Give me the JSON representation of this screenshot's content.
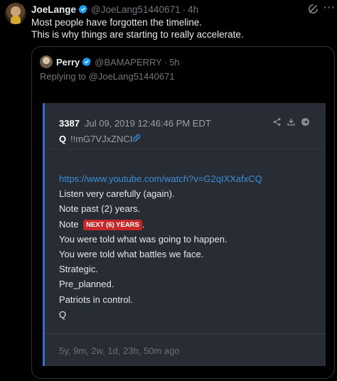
{
  "post": {
    "author_name": "JoeLange",
    "author_handle": "@JoeLang51440671",
    "separator": "·",
    "time": "4h",
    "text_lines": [
      "Most people have forgotten the timeline.",
      "This is why things are starting to really accelerate."
    ]
  },
  "quoted": {
    "author_name": "Perry",
    "author_handle": "@BAMAPERRY",
    "separator": "·",
    "time": "5h",
    "reply_text": "Replying to @JoeLang51440671"
  },
  "card": {
    "post_number": "3387",
    "date": "Jul 09, 2019 12:46:46 PM EDT",
    "q_label": "Q",
    "tripcode": "!!mG7VJxZNCI",
    "link": "https://www.youtube.com/watch?v=G2qIXXafxCQ",
    "lines": [
      "Listen very carefully (again).",
      "Note past (2) years."
    ],
    "note_prefix": "Note",
    "badge_text": "NEXT (6) YEARS",
    "note_suffix": ".",
    "lines_after": [
      "You were told what was going to happen.",
      "You were told what battles we face.",
      "Strategic.",
      "Pre_planned.",
      "Patriots in control.",
      "Q"
    ],
    "ago": "5y, 9m, 2w, 1d, 23h, 50m ago"
  },
  "colors": {
    "background": "#000000",
    "verified": "#1d9bf0",
    "card_bg": "#282c34",
    "card_accent": "#2f6fcf",
    "link": "#3a8fd8",
    "badge": "#c62828"
  },
  "icons": [
    "verified-icon",
    "grok-icon",
    "more-icon",
    "share-icon",
    "download-icon",
    "goto-icon",
    "link-icon"
  ]
}
